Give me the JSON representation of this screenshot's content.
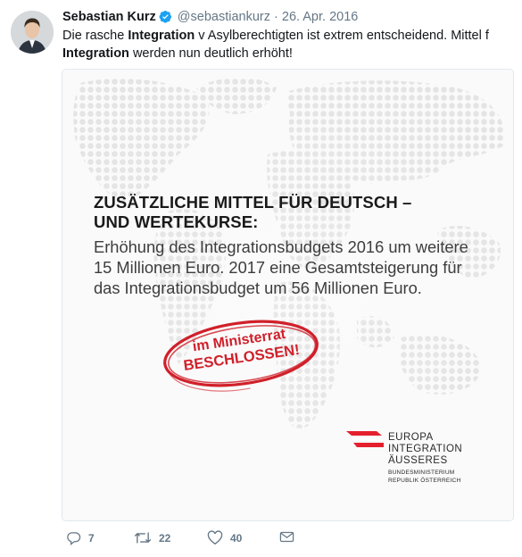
{
  "tweet": {
    "display_name": "Sebastian Kurz",
    "handle": "@sebastiankurz",
    "separator": "·",
    "date": "26. Apr. 2016",
    "text_part1": "Die rasche ",
    "text_bold1": "Integration",
    "text_part2": " v Asylberechtigten ist extrem entscheidend. Mittel f ",
    "text_bold2": "Integration",
    "text_part3": " werden nun deutlich erhöht!"
  },
  "card": {
    "headline_line1": "ZUSÄTZLICHE MITTEL FÜR DEUTSCH –",
    "headline_line2": "UND WERTEKURSE:",
    "body_line1": "Erhöhung des Integrationsbudgets 2016 um weitere",
    "body_line2": "15 Millionen Euro. 2017 eine Gesamtsteigerung für",
    "body_line3": "das Integrationsbudget um 56 Millionen Euro.",
    "stamp_line1": "im Ministerrat",
    "stamp_line2": "BESCHLOSSEN!",
    "logo_line1": "EUROPA",
    "logo_line2": "INTEGRATION",
    "logo_line3": "ÄUSSERES",
    "logo_line4": "BUNDESMINISTERIUM",
    "logo_line5": "REPUBLIK ÖSTERREICH"
  },
  "actions": {
    "reply_count": "7",
    "retweet_count": "22",
    "like_count": "40"
  },
  "icons": {
    "verified": "verified-badge-icon",
    "reply": "reply-icon",
    "retweet": "retweet-icon",
    "like": "heart-icon",
    "message": "envelope-icon"
  },
  "colors": {
    "verified": "#1da1f2",
    "stamp_red": "#d0202a",
    "logo_red": "#e4202e",
    "muted": "#657786"
  }
}
